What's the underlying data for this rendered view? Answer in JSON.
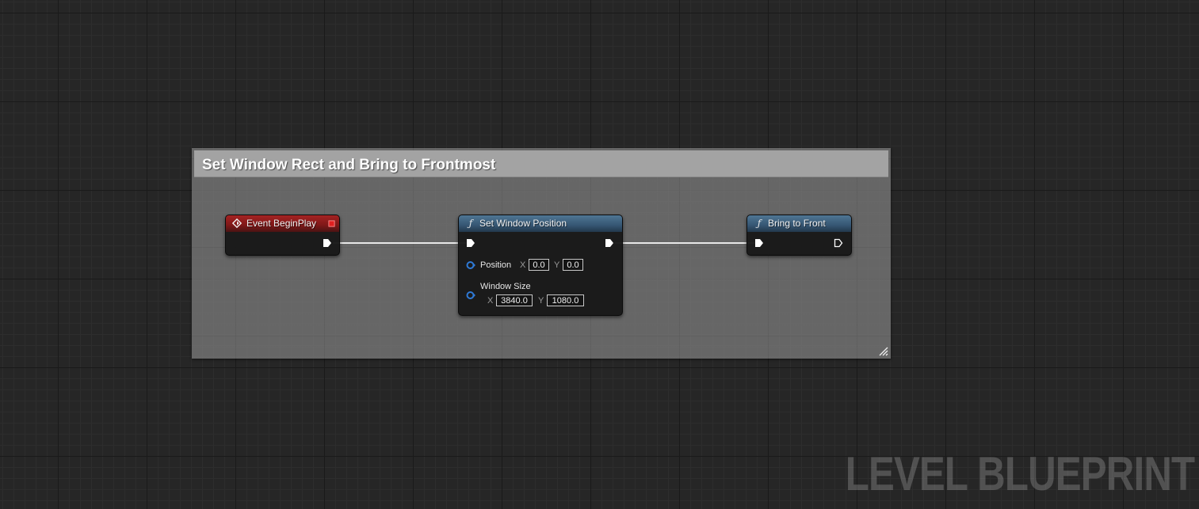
{
  "comment": {
    "title": "Set Window Rect and Bring to Frontmost"
  },
  "nodes": {
    "begin_play": {
      "title": "Event BeginPlay",
      "header_color": "#8e1c1c"
    },
    "set_window_position": {
      "title": "Set Window Position",
      "header_color": "#3a5f7a",
      "position_label": "Position",
      "position_x_axis": "X",
      "position_x": "0.0",
      "position_y_axis": "Y",
      "position_y": "0.0",
      "window_size_label": "Window Size",
      "window_size_x_axis": "X",
      "window_size_x": "3840.0",
      "window_size_y_axis": "Y",
      "window_size_y": "1080.0"
    },
    "bring_to_front": {
      "title": "Bring to Front",
      "header_color": "#3a5f7a"
    }
  },
  "icons": {
    "event": "event-diamond-icon",
    "function": "function-f-icon",
    "exec": "exec-pin-icon",
    "vector": "vector2d-pin-icon",
    "delegate": "delegate-square-icon",
    "resize": "resize-grip-icon"
  },
  "colors": {
    "exec_wire": "#e8e8e8",
    "vector_pin": "#2f7ad6",
    "delegate_pin": "#e02020"
  },
  "watermark": "LEVEL BLUEPRINT"
}
